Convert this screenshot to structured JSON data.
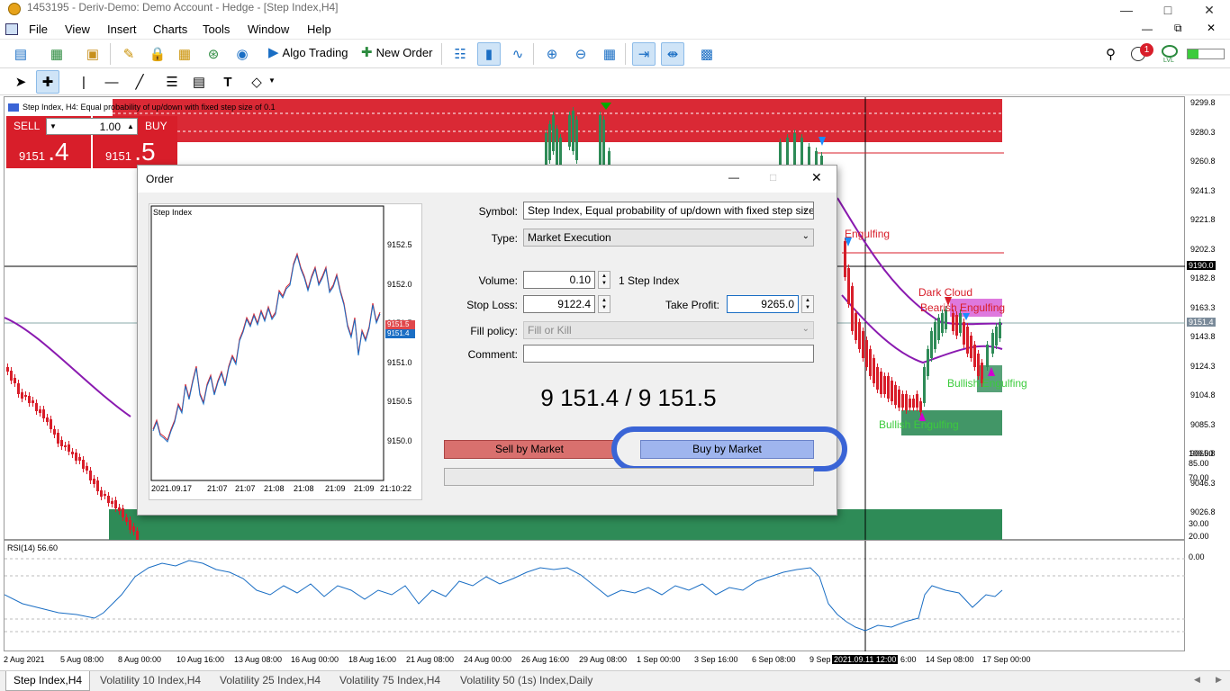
{
  "window": {
    "title": "1453195 - Deriv-Demo: Demo Account - Hedge - [Step Index,H4]"
  },
  "menu": [
    "File",
    "View",
    "Insert",
    "Charts",
    "Tools",
    "Window",
    "Help"
  ],
  "toolbar": {
    "algo_trading": "Algo Trading",
    "new_order": "New Order",
    "notification_count": "1",
    "lvl_label": "LVL"
  },
  "chart": {
    "title": "Step Index, H4:  Equal probability of up/down with fixed step size of 0.1",
    "price_labels": [
      "9299.8",
      "9280.3",
      "9260.8",
      "9241.3",
      "9221.8",
      "9202.3",
      "9182.8",
      "9163.3",
      "9143.8",
      "9124.3",
      "9104.8",
      "9085.3",
      "9065.8",
      "9046.3",
      "9026.8"
    ],
    "tag_level": "9190.0",
    "tag_bid": "9151.4",
    "annotations": {
      "engulfing": "Engulfing",
      "dark_cloud": "Dark Cloud",
      "bearish_engulfing": "Bearish Engulfing",
      "bullish_engulfing_1": "Bullish Engulfing",
      "bullish_engulfing_2": "Bullish Engulfing"
    }
  },
  "one_click": {
    "sell_label": "SELL",
    "buy_label": "BUY",
    "volume": "1.00",
    "sell_price_small": "9151",
    "sell_price_big": ".4",
    "buy_price_small": "9151",
    "buy_price_big": ".5"
  },
  "rsi": {
    "label": "RSI(14) 56.60",
    "levels": [
      "100.00",
      "85.00",
      "70.00",
      "30.00",
      "20.00",
      "0.00"
    ]
  },
  "x_axis": [
    "2 Aug 2021",
    "5 Aug 08:00",
    "8 Aug 00:00",
    "10 Aug 16:00",
    "13 Aug 08:00",
    "16 Aug 00:00",
    "18 Aug 16:00",
    "21 Aug 08:00",
    "24 Aug 00:00",
    "26 Aug 16:00",
    "29 Aug 08:00",
    "1 Sep 00:00",
    "3 Sep 16:00",
    "6 Sep 08:00",
    "9 Sep",
    "2021.09.11 12:00",
    "6:00",
    "14 Sep 08:00",
    "17 Sep 00:00"
  ],
  "tabs": [
    "Step Index,H4",
    "Volatility 10 Index,H4",
    "Volatility 25 Index,H4",
    "Volatility 75 Index,H4",
    "Volatility 50 (1s) Index,Daily"
  ],
  "order_dialog": {
    "title": "Order",
    "symbol_label": "Symbol:",
    "symbol_value": "Step Index, Equal probability of up/down with fixed step size of 0.1",
    "type_label": "Type:",
    "type_value": "Market Execution",
    "volume_label": "Volume:",
    "volume_value": "0.10",
    "volume_hint": "1 Step Index",
    "stop_loss_label": "Stop Loss:",
    "stop_loss_value": "9122.4",
    "take_profit_label": "Take Profit:",
    "take_profit_value": "9265.0",
    "fill_policy_label": "Fill policy:",
    "fill_policy_value": "Fill or Kill",
    "comment_label": "Comment:",
    "comment_value": "",
    "price_display": "9 151.4 / 9 151.5",
    "sell_button": "Sell by Market",
    "buy_button": "Buy by Market",
    "mini_chart": {
      "title": "Step Index",
      "y_labels": [
        "9152.5",
        "9152.0",
        "9151.5",
        "9151.0",
        "9150.5",
        "9150.0"
      ],
      "ask_tag": "9151.5",
      "bid_tag": "9151.4",
      "x_labels": [
        "2021.09.17",
        "21:07",
        "21:07",
        "21:08",
        "21:08",
        "21:09",
        "21:09",
        "21:10:22"
      ]
    }
  },
  "colors": {
    "bear": "#d81e2a",
    "bull": "#2e8b57",
    "ma": "#8a1ab0",
    "highlight_ring": "#3a64d6"
  }
}
